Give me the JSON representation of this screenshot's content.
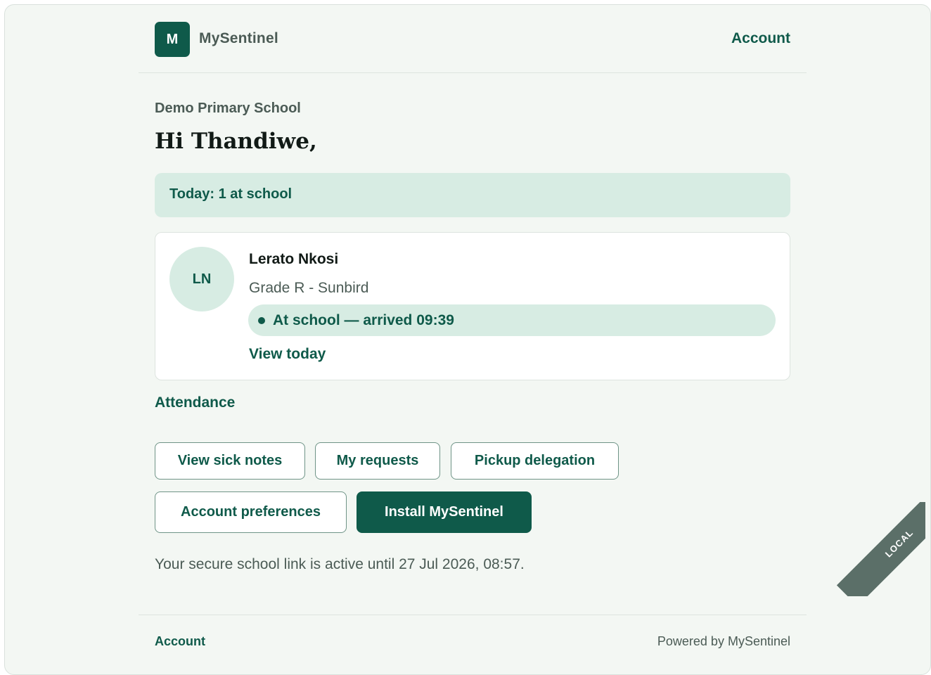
{
  "header": {
    "logo_letter": "M",
    "brand": "MySentinel",
    "account_link": "Account"
  },
  "school_name": "Demo Primary School",
  "greeting": "Hi Thandiwe,",
  "today_summary": "Today: 1 at school",
  "student": {
    "initials": "LN",
    "name": "Lerato Nkosi",
    "grade": "Grade R - Sunbird",
    "status": "At school — arrived 09:39",
    "view_link": "View today"
  },
  "attendance_link": "Attendance",
  "actions": {
    "sick_notes": "View sick notes",
    "requests": "My requests",
    "pickup": "Pickup delegation",
    "preferences": "Account preferences",
    "install": "Install MySentinel"
  },
  "link_status": "Your secure school link is active until 27 Jul 2026, 08:57.",
  "footer": {
    "account_link": "Account",
    "powered_by": "Powered by MySentinel"
  },
  "environment_ribbon": "LOCAL",
  "colors": {
    "brand_green": "#0f5a4a",
    "mint": "#d7ece3",
    "background": "#f3f7f3",
    "ribbon": "#5b6f68"
  }
}
